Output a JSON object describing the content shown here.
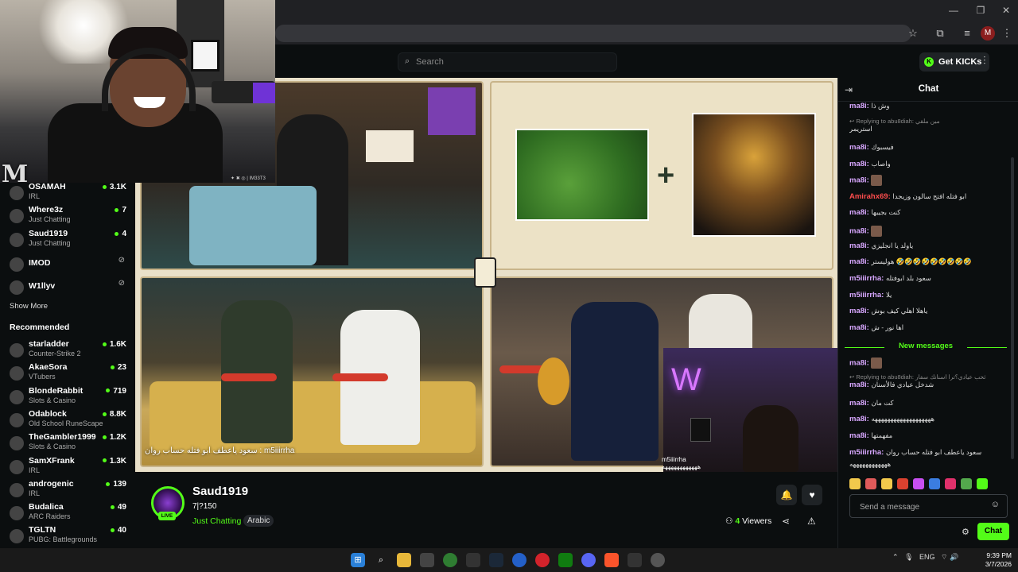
{
  "browser": {
    "profile_initial": "M"
  },
  "header": {
    "search_placeholder": "Search",
    "get_kicks_label": "Get KICKs"
  },
  "webcam": {
    "overlay_tag": "✦ ✖ ◎ | IM33T3"
  },
  "sidebar": {
    "following": [
      {
        "name": "OSAMAH",
        "category": "IRL",
        "viewers": "3.1K",
        "live": true
      },
      {
        "name": "Where3z",
        "category": "Just Chatting",
        "viewers": "7",
        "live": true
      },
      {
        "name": "Saud1919",
        "category": "Just Chatting",
        "viewers": "4",
        "live": true
      },
      {
        "name": "IMOD",
        "category": "",
        "viewers": "",
        "live": false
      },
      {
        "name": "W1llyv",
        "category": "",
        "viewers": "",
        "live": false
      }
    ],
    "show_more": "Show More",
    "recommended_title": "Recommended",
    "recommended": [
      {
        "name": "starladder",
        "category": "Counter-Strike 2",
        "viewers": "1.6K"
      },
      {
        "name": "AkaeSora",
        "category": "VTubers",
        "viewers": "23"
      },
      {
        "name": "BlondeRabbit",
        "category": "Slots & Casino",
        "viewers": "719"
      },
      {
        "name": "Odablock",
        "category": "Old School RuneScape",
        "viewers": "8.8K"
      },
      {
        "name": "TheGambler1999",
        "category": "Slots & Casino",
        "viewers": "1.2K"
      },
      {
        "name": "SamXFrank",
        "category": "IRL",
        "viewers": "1.3K"
      },
      {
        "name": "androgenic",
        "category": "IRL",
        "viewers": "139"
      },
      {
        "name": "Budalica",
        "category": "ARC Raiders",
        "viewers": "49"
      },
      {
        "name": "TGLTN",
        "category": "PUBG: Battlegrounds",
        "viewers": "40"
      }
    ]
  },
  "video": {
    "caption_user": "m5iiirrha",
    "caption_text": "سعود ياعطف ابو فتله حساب روان : ",
    "caption_extra": "ههههههههههههه",
    "cam2_caption": "m5iiirrha"
  },
  "stream": {
    "streamer": "Saud1919",
    "title": "7|?150",
    "live_label": "LIVE",
    "category": "Just Chatting",
    "tag": "Arabic",
    "viewers_count": "4",
    "viewers_label": "Viewers"
  },
  "chat": {
    "title": "Chat",
    "messages_before": [
      {
        "user": "ma8i",
        "color": "#d8a7ff",
        "text": "وش ذا",
        "reply": ""
      },
      {
        "user": "",
        "color": "",
        "text": "استريمر",
        "reply": "Replying to abu8diah: مين ملقي"
      },
      {
        "user": "ma8i",
        "color": "#d8a7ff",
        "text": "فيسبوك",
        "reply": ""
      },
      {
        "user": "ma8i",
        "color": "#d8a7ff",
        "text": "واصاب",
        "reply": ""
      },
      {
        "user": "ma8i",
        "color": "#d8a7ff",
        "text": "",
        "reply": ""
      },
      {
        "user": "Amirahx69",
        "color": "#ff4d4d",
        "text": "ابو فتله افتح سالون وزيجدا",
        "reply": ""
      },
      {
        "user": "ma8i",
        "color": "#d8a7ff",
        "text": "كنت بجيبها",
        "reply": ""
      },
      {
        "user": "ma8i",
        "color": "#d8a7ff",
        "text": "",
        "reply": ""
      },
      {
        "user": "ma8i",
        "color": "#d8a7ff",
        "text": "ياولد يا انجليزي",
        "reply": ""
      },
      {
        "user": "ma8i",
        "color": "#d8a7ff",
        "text": "هوليستر 🤣🤣🤣🤣🤣🤣🤣🤣🤣",
        "reply": ""
      },
      {
        "user": "m5iiirrha",
        "color": "#d8a7ff",
        "text": "سعود بلد ابوفتله",
        "reply": ""
      },
      {
        "user": "m5iiirrha",
        "color": "#d8a7ff",
        "text": "يلا",
        "reply": ""
      },
      {
        "user": "ma8i",
        "color": "#d8a7ff",
        "text": "ياهلا اهلي كيف بوش",
        "reply": ""
      },
      {
        "user": "ma8i",
        "color": "#d8a7ff",
        "text": "اها نور - ش",
        "reply": ""
      }
    ],
    "new_messages_label": "New messages",
    "messages_after": [
      {
        "user": "ma8i",
        "color": "#d8a7ff",
        "text": "",
        "reply": ""
      },
      {
        "user": "ma8i",
        "color": "#d8a7ff",
        "text": "شدخل عيادي فالأسنان",
        "reply": "Replying to abu8diah: ثحب عيادي؟ترا اسنانك سفار"
      },
      {
        "user": "ma8i",
        "color": "#d8a7ff",
        "text": "كت مان",
        "reply": ""
      },
      {
        "user": "ma8i",
        "color": "#d8a7ff",
        "text": "هههههههههههههههههههه",
        "reply": ""
      },
      {
        "user": "ma8i",
        "color": "#d8a7ff",
        "text": "مفهمتها",
        "reply": ""
      },
      {
        "user": "m5iiirrha",
        "color": "#d8a7ff",
        "text": "سعود ياعطف ابو فتله حساب روان",
        "reply": ""
      },
      {
        "user": "",
        "color": "",
        "text": "ههههههههههههه",
        "reply": ""
      }
    ],
    "input_placeholder": "Send a message",
    "send_label": "Chat"
  },
  "taskbar": {
    "language": "ENG",
    "time": "9:39 PM",
    "date": "3/7/2026"
  },
  "colors": {
    "accent": "#53fc18",
    "background": "#0b0e0f"
  }
}
